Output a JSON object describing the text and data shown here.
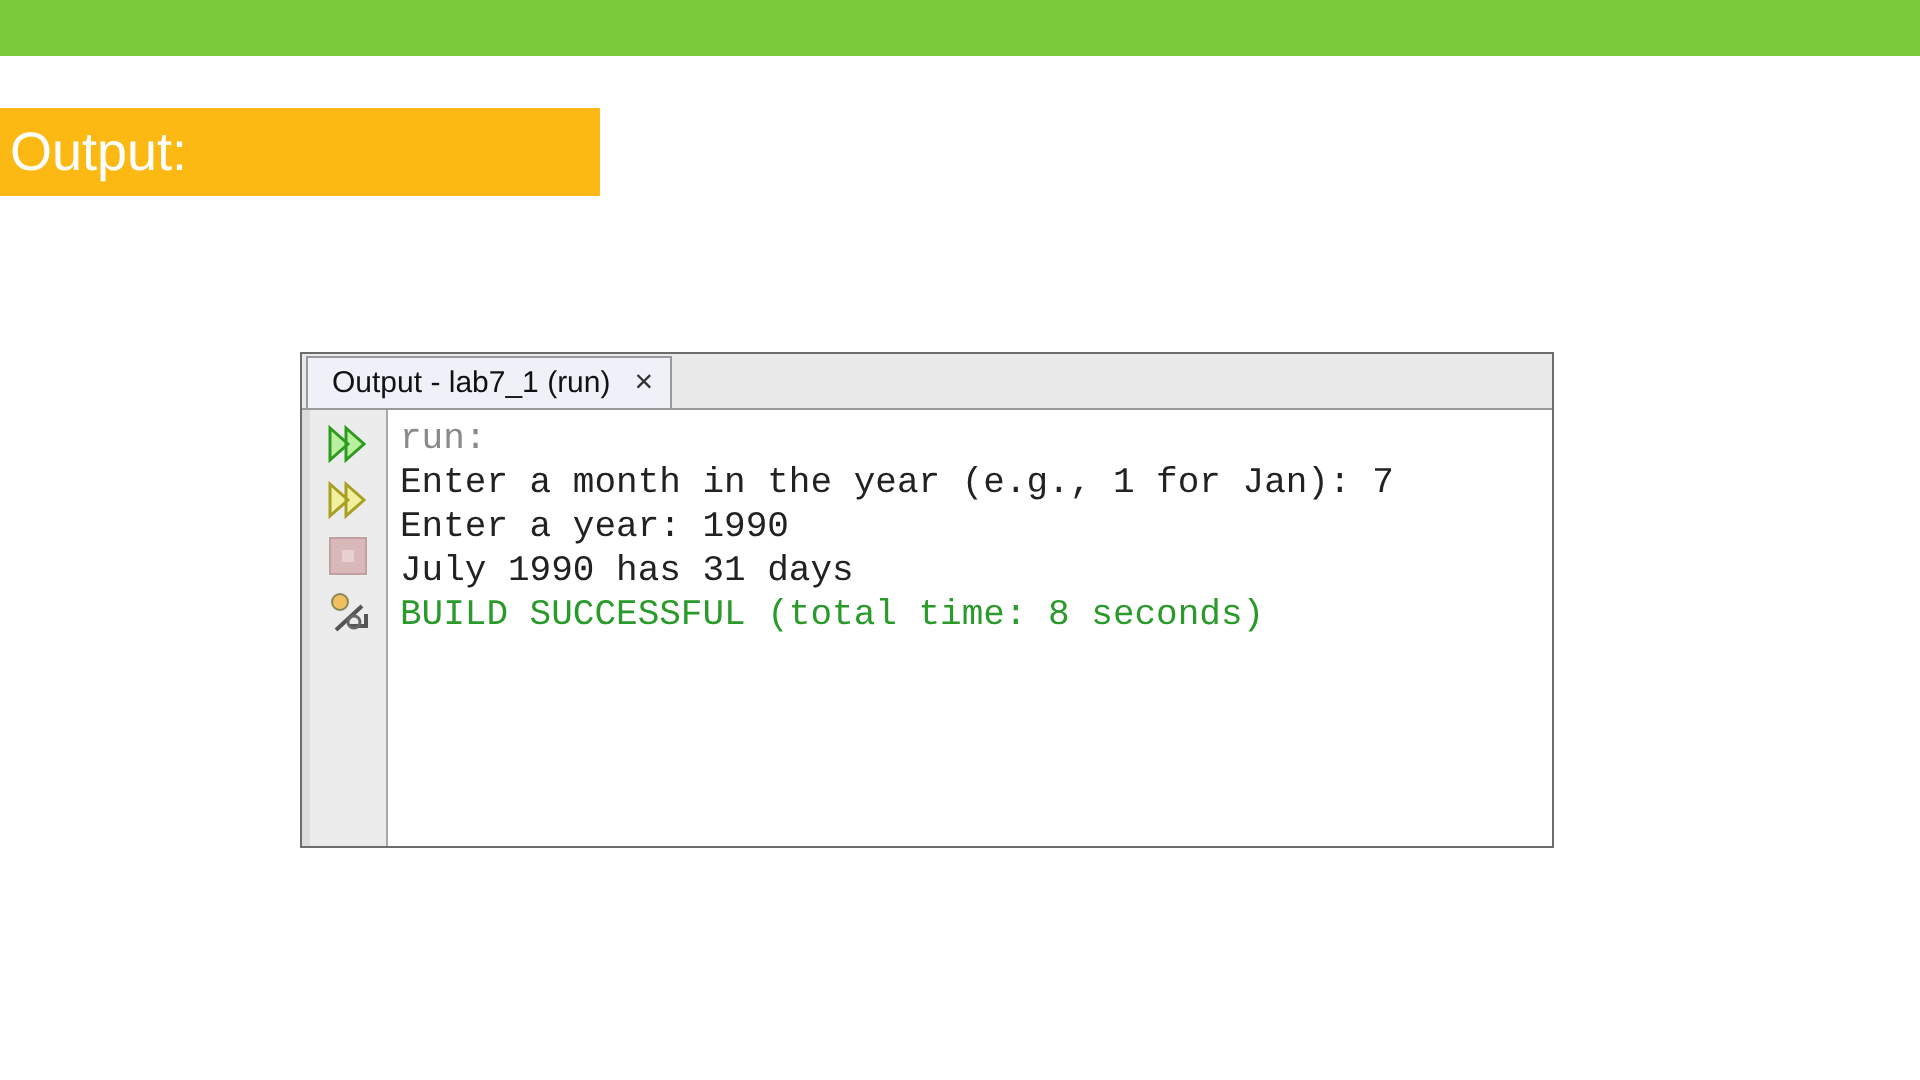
{
  "slide": {
    "heading": "Output:"
  },
  "output_window": {
    "tab": {
      "label": "Output - lab7_1 (run)",
      "close": "×",
      "selected": true
    },
    "lines": [
      {
        "text": "run:",
        "kind": "muted"
      },
      {
        "text": "Enter a month in the year (e.g., 1 for Jan): 7",
        "kind": "normal"
      },
      {
        "text": "Enter a year: 1990",
        "kind": "normal"
      },
      {
        "text": "July 1990 has 31 days",
        "kind": "normal"
      },
      {
        "text": "BUILD SUCCESSFUL (total time: 8 seconds)",
        "kind": "success"
      }
    ]
  }
}
